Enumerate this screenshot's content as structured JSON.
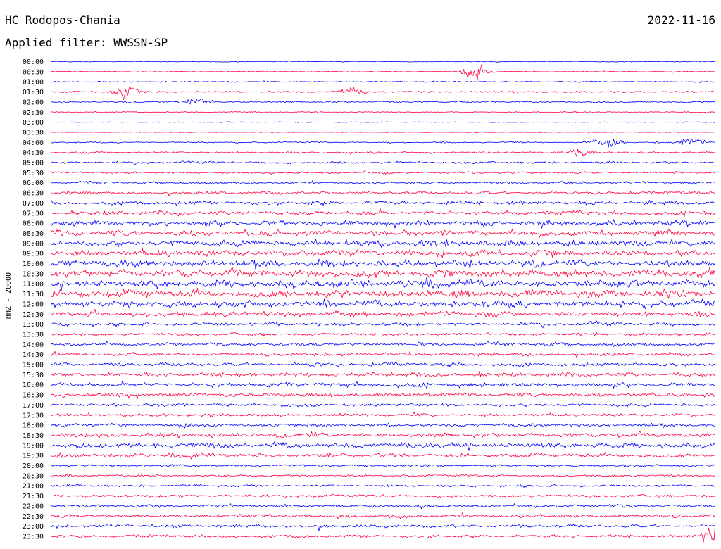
{
  "header": {
    "station": "HC Rodopos-Chania",
    "date": "2022-11-16",
    "filter": "Applied filter: WWSSN-SP"
  },
  "chart_data": {
    "type": "line",
    "title": "HC Rodopos-Chania",
    "ylabel": "HHZ - 20000",
    "colors": {
      "blue": "#0000ff",
      "red": "#ff0040"
    },
    "color_order": [
      "blue",
      "red"
    ],
    "row_labels": [
      "00:00",
      "00:30",
      "01:00",
      "01:30",
      "02:00",
      "02:30",
      "03:00",
      "03:30",
      "04:00",
      "04:30",
      "05:00",
      "05:30",
      "06:00",
      "06:30",
      "07:00",
      "07:30",
      "08:00",
      "08:30",
      "09:00",
      "09:30",
      "10:00",
      "10:30",
      "11:00",
      "11:30",
      "12:00",
      "12:30",
      "13:00",
      "13:30",
      "14:00",
      "14:30",
      "15:00",
      "15:30",
      "16:00",
      "16:30",
      "17:00",
      "17:30",
      "18:00",
      "18:30",
      "19:00",
      "19:30",
      "20:00",
      "20:30",
      "21:00",
      "21:30",
      "22:00",
      "22:30",
      "23:00",
      "23:30"
    ],
    "noise_levels": [
      0.12,
      0.12,
      0.15,
      0.22,
      0.22,
      0.15,
      0.1,
      0.08,
      0.18,
      0.25,
      0.3,
      0.28,
      0.3,
      0.4,
      0.48,
      0.55,
      0.65,
      0.75,
      0.75,
      0.85,
      0.9,
      1.0,
      1.0,
      0.95,
      0.9,
      0.7,
      0.45,
      0.4,
      0.45,
      0.45,
      0.5,
      0.55,
      0.55,
      0.5,
      0.4,
      0.38,
      0.45,
      0.6,
      0.7,
      0.55,
      0.3,
      0.28,
      0.3,
      0.35,
      0.4,
      0.45,
      0.42,
      0.38
    ],
    "events": [
      {
        "row": 1,
        "pos": 0.64,
        "amp": 1.8
      },
      {
        "row": 3,
        "pos": 0.11,
        "amp": 1.6
      },
      {
        "row": 3,
        "pos": 0.45,
        "amp": 0.8
      },
      {
        "row": 4,
        "pos": 0.22,
        "amp": 1.4
      },
      {
        "row": 8,
        "pos": 0.84,
        "amp": 1.2
      },
      {
        "row": 8,
        "pos": 0.96,
        "amp": 1.2
      },
      {
        "row": 9,
        "pos": 0.8,
        "amp": 1.0
      },
      {
        "row": 47,
        "pos": 0.998,
        "amp": 2.6
      }
    ]
  }
}
